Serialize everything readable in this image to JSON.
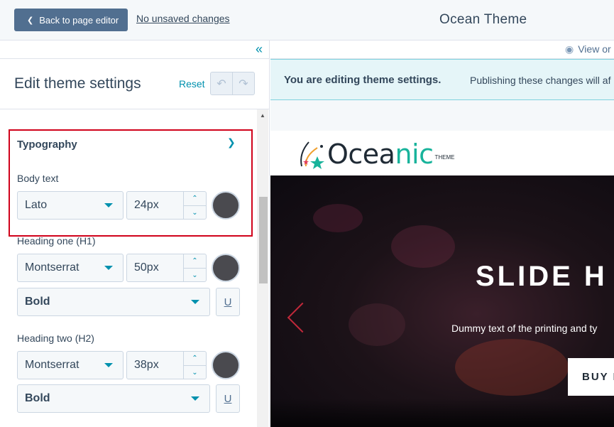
{
  "topbar": {
    "back_label": "Back to page editor",
    "unsaved_label": "No unsaved changes",
    "theme_title": "Ocean Theme"
  },
  "panel": {
    "title": "Edit theme settings",
    "reset_label": "Reset"
  },
  "typography": {
    "section_title": "Typography",
    "fields": [
      {
        "label": "Body text",
        "font": "Lato",
        "size": "24px",
        "color": "#4a4a4f"
      },
      {
        "label": "Heading one (H1)",
        "font": "Montserrat",
        "size": "50px",
        "color": "#4a4a4f",
        "weight": "Bold",
        "underline": "U"
      },
      {
        "label": "Heading two (H2)",
        "font": "Montserrat",
        "size": "38px",
        "color": "#4a4a4f",
        "weight": "Bold",
        "underline": "U"
      }
    ]
  },
  "preview": {
    "view_label": "View or",
    "notice_bold": "You are editing theme settings.",
    "notice_text": "Publishing these changes will af",
    "logo_pre": "Ocea",
    "logo_accent": "nic",
    "logo_sub": "THEME",
    "hero_title": "SLIDE H",
    "hero_sub": "Dummy text of the printing and ty",
    "buy_label": "BUY I"
  },
  "colors": {
    "accent": "#0091ae",
    "highlight": "#d0021b",
    "back_button": "#516f90"
  }
}
